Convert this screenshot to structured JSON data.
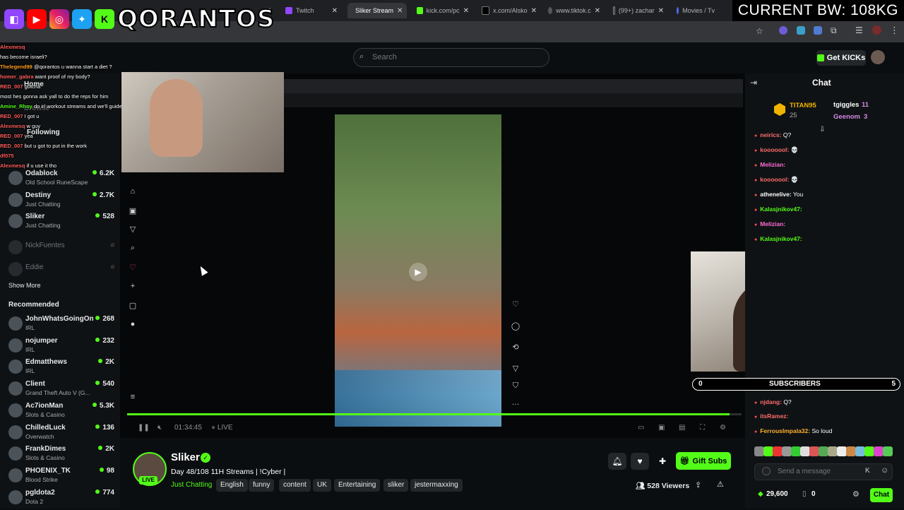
{
  "browser": {
    "tabs": [
      {
        "label": "",
        "active": false
      },
      {
        "label": "Twitch",
        "active": false
      },
      {
        "label": "Sliker Stream",
        "active": true
      },
      {
        "label": "kick.com/pc",
        "active": false
      },
      {
        "label": "x.com/Alsko",
        "active": false
      },
      {
        "label": "www.tiktok.c",
        "active": false
      },
      {
        "label": "(99+) zachar",
        "active": false
      },
      {
        "label": "Movies / Tv",
        "active": false
      }
    ]
  },
  "overlay": {
    "bw_label": "CURRENT BW: 108KG",
    "channel_logo": "QORANTOS",
    "social_icons": [
      "twitch-icon",
      "youtube-icon",
      "instagram-icon",
      "twitter-icon",
      "kick-icon"
    ]
  },
  "header": {
    "search_placeholder": "Search",
    "get_kicks_label": "Get KICKs"
  },
  "left_chat": [
    {
      "user": "Alexmesq",
      "text": ""
    },
    {
      "user": "",
      "text": "has become israeli?"
    },
    {
      "user": "Thelegend99",
      "text": "@qorantos u wanna start a diet ?"
    },
    {
      "user": "homer_gabra",
      "text": "want proof of my body?"
    },
    {
      "user": "RED_007",
      "text": "gotcha"
    },
    {
      "user": "",
      "text": "most hes gonna ask yall to do the reps for him"
    },
    {
      "user": "Amine_Rhoy",
      "text": "do irl workout streams and we'll guide u"
    },
    {
      "user": "RED_007",
      "text": "I got u"
    },
    {
      "user": "Alexmesq",
      "text": "w guy"
    },
    {
      "user": "RED_007",
      "text": "yea"
    },
    {
      "user": "RED_007",
      "text": "but u got to put in the work"
    },
    {
      "user": "df075",
      "text": ""
    },
    {
      "user": "Alexmesq",
      "text": "if u use it tho"
    }
  ],
  "sidebar": {
    "home_label": "Home",
    "browse_label": "Browse",
    "following_label": "Following",
    "following": [
      {
        "name": "Odablock",
        "category": "Old School RuneScape",
        "viewers": "6.2K",
        "online": true
      },
      {
        "name": "Destiny",
        "category": "Just Chatting",
        "viewers": "2.7K",
        "online": true
      },
      {
        "name": "Sliker",
        "category": "Just Chatting",
        "viewers": "528",
        "online": true
      },
      {
        "name": "NickFuentes",
        "category": "",
        "viewers": "",
        "online": false
      },
      {
        "name": "Eddie",
        "category": "",
        "viewers": "",
        "online": false
      }
    ],
    "show_more_label": "Show More",
    "recommended_label": "Recommended",
    "recommended": [
      {
        "name": "JohnWhatsGoingOn",
        "category": "IRL",
        "viewers": "268"
      },
      {
        "name": "nojumper",
        "category": "IRL",
        "viewers": "232"
      },
      {
        "name": "Edmatthews",
        "category": "IRL",
        "viewers": "2K"
      },
      {
        "name": "Client",
        "category": "Grand Theft Auto V (G...",
        "viewers": "540"
      },
      {
        "name": "Ac7ionMan",
        "category": "Slots & Casino",
        "viewers": "5.3K"
      },
      {
        "name": "ChilledLuck",
        "category": "Overwatch",
        "viewers": "136"
      },
      {
        "name": "FrankDimes",
        "category": "Slots & Casino",
        "viewers": "2K"
      },
      {
        "name": "PHOENIX_TK",
        "category": "Blood Strike",
        "viewers": "98"
      },
      {
        "name": "pgldota2",
        "category": "Dota 2",
        "viewers": "774"
      }
    ]
  },
  "player": {
    "time": "01:34:45",
    "live_label": "LIVE",
    "progress": 0.98
  },
  "stream": {
    "streamer": "Sliker",
    "live_badge": "LIVE",
    "title": "Day 48/108 11H Streams | !Cyber |",
    "category": "Just Chatting",
    "tags": [
      "English",
      "funny",
      "content",
      "UK",
      "Entertaining",
      "sliker",
      "jestermaxxing"
    ],
    "viewers": "528 Viewers",
    "gift_subs_label": "Gift Subs"
  },
  "chat": {
    "title": "Chat",
    "gifters": [
      {
        "name": "TITAN95",
        "count": "25"
      },
      {
        "name": "tgiggles",
        "count": "11"
      },
      {
        "name": "Geenom",
        "count": "3"
      }
    ],
    "messages": [
      {
        "user": "neirics:",
        "text": "Q?",
        "color": "#ff6b6b"
      },
      {
        "user": "kooooool:",
        "text": "💀",
        "color": "#ff6b6b"
      },
      {
        "user": "Melizian:",
        "text": "",
        "color": "#ff6bd5"
      },
      {
        "user": "kooooool:",
        "text": "💀",
        "color": "#ff6b6b"
      },
      {
        "user": "athenelive:",
        "text": "You",
        "color": "#ffffff"
      },
      {
        "user": "Kalasjnikov47:",
        "text": "",
        "color": "#53fc18"
      },
      {
        "user": "Melizian:",
        "text": "",
        "color": "#ff6bd5"
      },
      {
        "user": "Kalasjnikov47:",
        "text": "",
        "color": "#53fc18"
      },
      {
        "user": "njdang:",
        "text": "Q?",
        "color": "#ff6b6b"
      },
      {
        "user": "itsRamez:",
        "text": "",
        "color": "#ff6b6b"
      },
      {
        "user": "FerrousImpala32:",
        "text": "So loud",
        "color": "#ffb02e"
      }
    ],
    "sub_bar": {
      "label": "SUBSCRIBERS",
      "current": "0",
      "goal": "5"
    },
    "input_placeholder": "Send a message",
    "kicks_balance": "29,600",
    "points": "0",
    "chat_button": "Chat"
  }
}
